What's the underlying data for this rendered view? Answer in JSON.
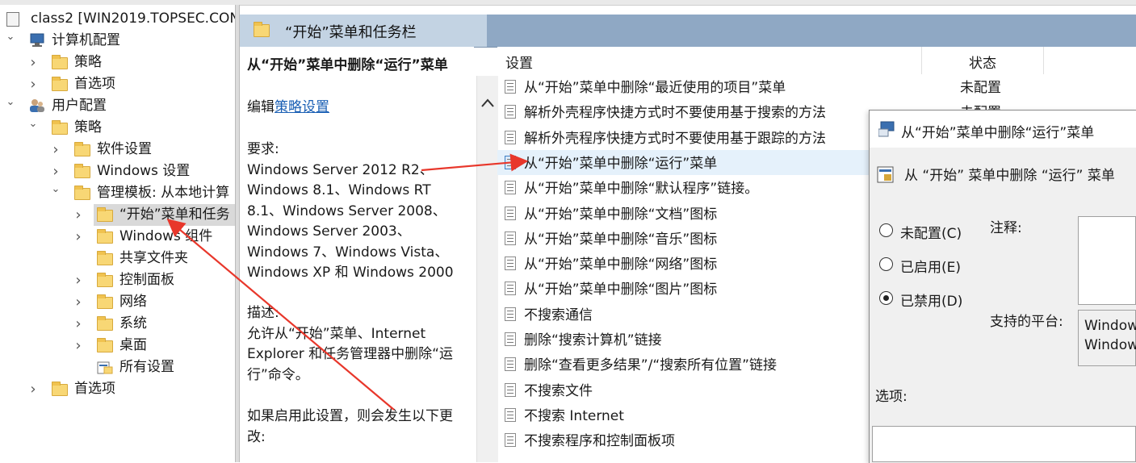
{
  "tree": {
    "root_label": "class2 [WIN2019.TOPSEC.CON",
    "items": [
      {
        "label": "计算机配置",
        "icon": "computer-icon",
        "chevron": "expanded"
      },
      {
        "label": "策略",
        "icon": "folder-icon",
        "chevron": "collapsed"
      },
      {
        "label": "首选项",
        "icon": "folder-icon",
        "chevron": "collapsed"
      },
      {
        "label": "用户配置",
        "icon": "users-icon",
        "chevron": "expanded"
      },
      {
        "label": "策略",
        "icon": "folder-icon",
        "chevron": "expanded"
      },
      {
        "label": "软件设置",
        "icon": "folder-icon",
        "chevron": "collapsed"
      },
      {
        "label": "Windows 设置",
        "icon": "folder-icon",
        "chevron": "collapsed"
      },
      {
        "label": "管理模板: 从本地计算",
        "icon": "folder-icon",
        "chevron": "expanded"
      },
      {
        "label": "“开始”菜单和任务",
        "icon": "folder-icon",
        "chevron": "collapsed",
        "selected": true
      },
      {
        "label": "Windows 组件",
        "icon": "folder-icon",
        "chevron": "collapsed"
      },
      {
        "label": "共享文件夹",
        "icon": "folder-icon",
        "chevron": "none"
      },
      {
        "label": "控制面板",
        "icon": "folder-icon",
        "chevron": "collapsed"
      },
      {
        "label": "网络",
        "icon": "folder-icon",
        "chevron": "collapsed"
      },
      {
        "label": "系统",
        "icon": "folder-icon",
        "chevron": "collapsed"
      },
      {
        "label": "桌面",
        "icon": "folder-icon",
        "chevron": "collapsed"
      },
      {
        "label": "所有设置",
        "icon": "all-settings-icon",
        "chevron": "none"
      },
      {
        "label": "首选项",
        "icon": "folder-icon",
        "chevron": "collapsed"
      }
    ]
  },
  "header": {
    "title": "“开始”菜单和任务栏"
  },
  "description": {
    "title": "从“开始”菜单中删除“运行”菜单",
    "edit_prefix": "编辑",
    "edit_link": "策略设置",
    "requirements_label": "要求:",
    "requirements_lines": [
      "Windows Server 2012 R2、",
      "Windows 8.1、Windows RT",
      "8.1、Windows Server 2008、",
      "Windows Server 2003、",
      "Windows 7、Windows Vista、",
      "Windows XP 和 Windows 2000"
    ],
    "desc_label": "描述:",
    "desc_lines": [
      "允许从“开始”菜单、Internet",
      "Explorer 和任务管理器中删除“运",
      "行”命令。"
    ],
    "more_lines": [
      "如果启用此设置，则会发生以下更",
      "改:"
    ]
  },
  "list": {
    "col_setting": "设置",
    "col_state": "状态",
    "rows": [
      {
        "label": "从“开始”菜单中删除“最近使用的项目”菜单",
        "state": "未配置"
      },
      {
        "label": "解析外壳程序快捷方式时不要使用基于搜索的方法",
        "state": "未配置"
      },
      {
        "label": "解析外壳程序快捷方式时不要使用基于跟踪的方法",
        "state": ""
      },
      {
        "label": "从“开始”菜单中删除“运行”菜单",
        "state": "",
        "highlight": true
      },
      {
        "label": "从“开始”菜单中删除“默认程序”链接。",
        "state": ""
      },
      {
        "label": "从“开始”菜单中删除“文档”图标",
        "state": ""
      },
      {
        "label": "从“开始”菜单中删除“音乐”图标",
        "state": ""
      },
      {
        "label": "从“开始”菜单中删除“网络”图标",
        "state": ""
      },
      {
        "label": "从“开始”菜单中删除“图片”图标",
        "state": ""
      },
      {
        "label": "不搜索通信",
        "state": ""
      },
      {
        "label": "删除“搜索计算机”链接",
        "state": ""
      },
      {
        "label": "删除“查看更多结果”/“搜索所有位置”链接",
        "state": ""
      },
      {
        "label": "不搜索文件",
        "state": ""
      },
      {
        "label": "不搜索 Internet",
        "state": ""
      },
      {
        "label": "不搜索程序和控制面板项",
        "state": ""
      }
    ]
  },
  "dialog": {
    "title": "从“开始”菜单中删除“运行”菜单",
    "subtitle": "从 “开始” 菜单中删除 “运行” 菜单",
    "radio_not_configured": "未配置(C)",
    "radio_enabled": "已启用(E)",
    "radio_disabled": "已禁用(D)",
    "selected": "disabled",
    "comment_label": "注释:",
    "platform_label": "支持的平台:",
    "platform_lines": [
      "Window",
      "Window"
    ],
    "options_label": "选项:"
  },
  "colors": {
    "header_band": "#8fa8c4",
    "annotation_arrow": "#e8372b",
    "selection_row": "#e5f1fb",
    "link": "#1a5fb4"
  }
}
